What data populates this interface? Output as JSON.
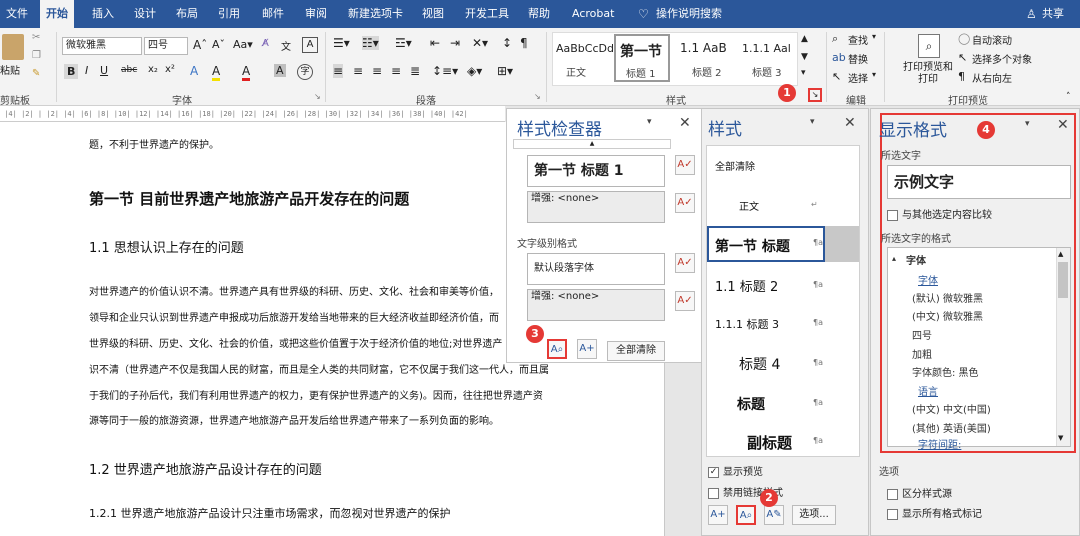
{
  "tabs": [
    "文件",
    "开始",
    "插入",
    "设计",
    "布局",
    "引用",
    "邮件",
    "审阅",
    "新建选项卡",
    "视图",
    "开发工具",
    "帮助",
    "Acrobat",
    "操作说明搜索"
  ],
  "share": "共享",
  "ribbon": {
    "paste": "粘贴",
    "clipboard": "剪贴板",
    "font_name": "微软雅黑",
    "font_size": "四号",
    "font_group": "字体",
    "para_group": "段落",
    "style_group": "样式",
    "edit_group": "编辑",
    "preview_group": "打印预览",
    "find": "查找",
    "replace": "替换",
    "select": "选择",
    "print_preview": "打印预览和打印",
    "autoscroll": "自动滚动",
    "select_multi": "选择多个对象",
    "rtl": "从右向左",
    "gallery": [
      {
        "sample": "AaBbCcDd",
        "name": "正文"
      },
      {
        "sample": "第一节",
        "name": "标题 1"
      },
      {
        "sample": "1.1 AaB",
        "name": "标题 2"
      },
      {
        "sample": "1.1.1 Aal",
        "name": "标题 3"
      }
    ],
    "font_btns": [
      "B",
      "I",
      "U",
      "abc",
      "x₂",
      "x²",
      "A",
      "A",
      "A",
      "A"
    ]
  },
  "doc": {
    "lines": [
      "题，不利于世界遗产的保护。",
      "第一节      目前世界遗产地旅游产品开发存在的问题",
      "1.1  思想认识上存在的问题",
      "对世界遗产的价值认识不清。世界遗产具有世界级的科研、历史、文化、社会和审美等价值，",
      "领导和企业只认识到世界遗产申报成功后旅游开发给当地带来的巨大经济收益即经济价值，而",
      "世界级的科研、历史、文化、社会的价值，或把这些价值置于次于经济价值的地位;对世界遗产",
      "识不清（世界遗产不仅是我国人民的财富，而且是全人类的共同财富，它不仅属于我们这一代人，而且属",
      "于我们的子孙后代，我们有利用世界遗产的权力，更有保护世界遗产的义务)。因而，往往把世界遗产资",
      "源等同于一般的旅游资源，世界遗产地旅游产品开发后给世界遗产带来了一系列负面的影响。",
      "1.2  世界遗产地旅游产品设计存在的问题",
      "1.2.1      世界遗产地旅游产品设计只注重市场需求，而忽视对世界遗产的保护"
    ]
  },
  "inspector": {
    "title": "样式检查器",
    "para_style": "第一节  标题 1",
    "plus1": "增强: <none>",
    "text_level": "文字级别格式",
    "default_font": "默认段落字体",
    "plus2": "增强: <none>",
    "clear_all": "全部清除"
  },
  "styles": {
    "title": "样式",
    "items": [
      "全部清除",
      "正文",
      "第一节  标题",
      "1.1  标题 2",
      "1.1.1  标题 3",
      "标题 4",
      "标题",
      "副标题"
    ],
    "show_preview": "显示预览",
    "disable_linked": "禁用链接样式",
    "options": "选项..."
  },
  "reveal": {
    "title": "显示格式",
    "selected_text_label": "所选文字",
    "sample": "示例文字",
    "compare": "与其他选定内容比较",
    "format_label": "所选文字的格式",
    "tree": [
      "字体",
      "字体",
      "(默认) 微软雅黑",
      "(中文) 微软雅黑",
      "四号",
      "加粗",
      "字体颜色: 黑色",
      "语言",
      "(中文) 中文(中国)",
      "(其他) 英语(美国)",
      "字符间距:"
    ],
    "options_label": "选项",
    "distinguish": "区分样式源",
    "show_all": "显示所有格式标记"
  },
  "badges": [
    "1",
    "2",
    "3",
    "4"
  ],
  "colors": {
    "brand": "#2b579a",
    "highlight": "#e53935"
  }
}
